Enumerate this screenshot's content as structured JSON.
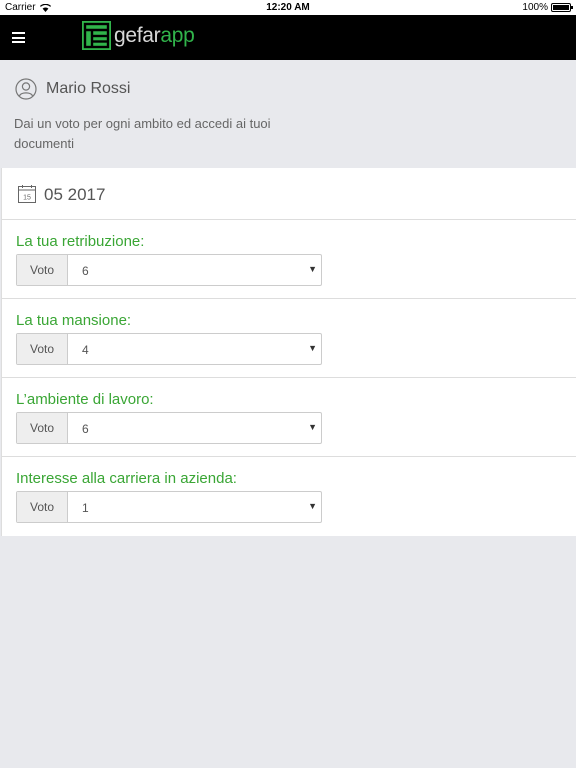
{
  "status_bar": {
    "carrier": "Carrier",
    "time": "12:20 AM",
    "battery": "100%",
    "battery_level": 1.0
  },
  "header": {
    "logo_text_main": "gefar",
    "logo_text_accent": "app",
    "colors": {
      "background": "#000000",
      "brand": "#31b44b"
    }
  },
  "profile": {
    "name": "Mario Rossi",
    "hint": "Dai un voto per ogni ambito ed accedi ai tuoi documenti"
  },
  "period": {
    "calendar_day": "15",
    "label": "05 2017"
  },
  "questions": [
    {
      "label": "La tua retribuzione:",
      "addon": "Voto",
      "value": "6"
    },
    {
      "label": "La tua mansione:",
      "addon": "Voto",
      "value": "4"
    },
    {
      "label": "L’ambiente di lavoro:",
      "addon": "Voto",
      "value": "6"
    },
    {
      "label": "Interesse alla carriera in azienda:",
      "addon": "Voto",
      "value": "1"
    }
  ],
  "icons": {
    "menu": "hamburger-menu-icon",
    "user": "user-icon",
    "calendar": "calendar-icon",
    "select": "caret-down-icon",
    "wifi": "wifi-icon"
  },
  "colors": {
    "label_green": "#3aa635",
    "page_bg": "#e8e9ed"
  }
}
